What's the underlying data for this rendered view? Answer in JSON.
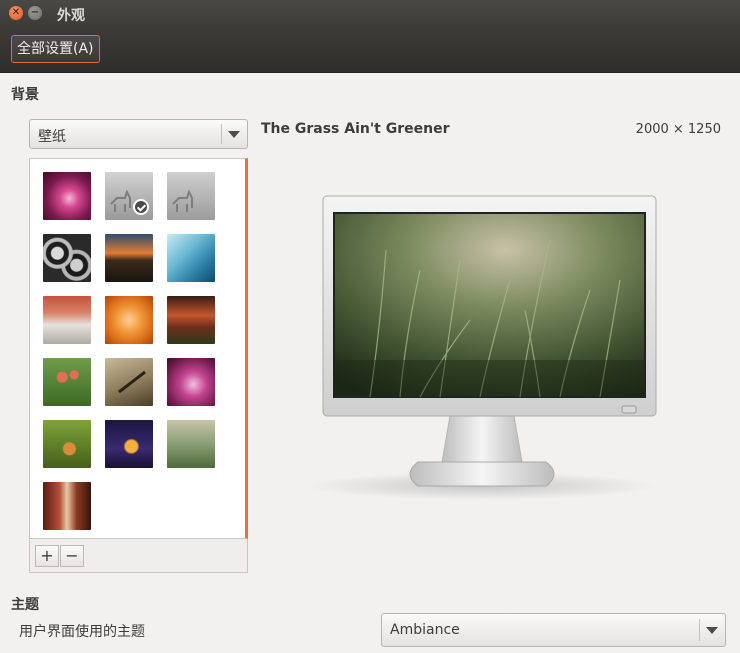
{
  "window": {
    "title": "外观"
  },
  "toolbar": {
    "all_settings_label": "全部设置(A)"
  },
  "background_section": {
    "title": "背景",
    "source_combo": {
      "selected": "壁纸"
    },
    "thumbnails": [
      {
        "name": "purple-burst"
      },
      {
        "name": "grey-deer",
        "selected": true
      },
      {
        "name": "grey-deer-2"
      },
      {
        "name": "disk-array"
      },
      {
        "name": "sunset-city"
      },
      {
        "name": "blue-water"
      },
      {
        "name": "red-trees"
      },
      {
        "name": "orange-leaves"
      },
      {
        "name": "dark-sunset"
      },
      {
        "name": "red-flowers"
      },
      {
        "name": "pen"
      },
      {
        "name": "pink-flower"
      },
      {
        "name": "green-field"
      },
      {
        "name": "night-fox"
      },
      {
        "name": "grass"
      },
      {
        "name": "bottles"
      }
    ],
    "add_label": "+",
    "remove_label": "−",
    "current_wallpaper": {
      "name": "The Grass Ain't Greener",
      "size": "2000 × 1250"
    }
  },
  "theme_section": {
    "title": "主题",
    "row_label": "用户界面使用的主题",
    "combo": {
      "selected": "Ambiance"
    }
  }
}
